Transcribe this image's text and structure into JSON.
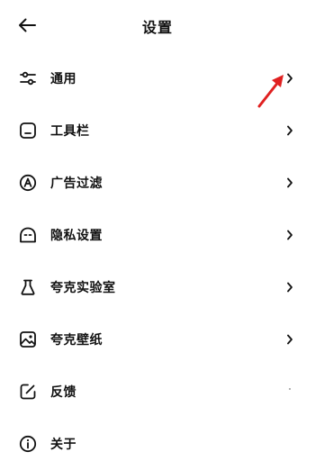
{
  "header": {
    "title": "设置",
    "back_icon": "arrow-left-icon"
  },
  "settings": {
    "items": [
      {
        "label": "通用",
        "icon": "sliders-icon",
        "has_chevron": true
      },
      {
        "label": "工具栏",
        "icon": "toolbar-icon",
        "has_chevron": true
      },
      {
        "label": "广告过滤",
        "icon": "ad-filter-icon",
        "has_chevron": true
      },
      {
        "label": "隐私设置",
        "icon": "privacy-icon",
        "has_chevron": true
      },
      {
        "label": "夸克实验室",
        "icon": "flask-icon",
        "has_chevron": true
      },
      {
        "label": "夸克壁纸",
        "icon": "wallpaper-icon",
        "has_chevron": true
      },
      {
        "label": "反馈",
        "icon": "feedback-edit-icon",
        "has_chevron": false
      },
      {
        "label": "关于",
        "icon": "info-icon",
        "has_chevron": false
      }
    ]
  },
  "colors": {
    "text": "#111111",
    "background": "#ffffff",
    "annotation": "#e02020"
  }
}
